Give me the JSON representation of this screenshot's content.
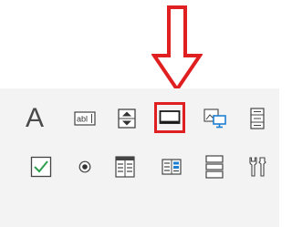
{
  "toolbox": {
    "label_tool_glyph": "A",
    "textbox_tool_text": "abl",
    "highlighted_tool": "rectangle-tool",
    "highlight_color": "#e02020",
    "arrow_color": "#e02020"
  },
  "icons": {
    "row1": [
      "label-icon",
      "textbox-icon",
      "spinner-icon",
      "rectangle-icon",
      "image-monitor-icon",
      "list-scroll-icon"
    ],
    "row2": [
      "checkbox-icon",
      "radio-button-icon",
      "datagrid-icon",
      "multi-list-icon",
      "stacked-panels-icon",
      "tools-icon"
    ]
  }
}
